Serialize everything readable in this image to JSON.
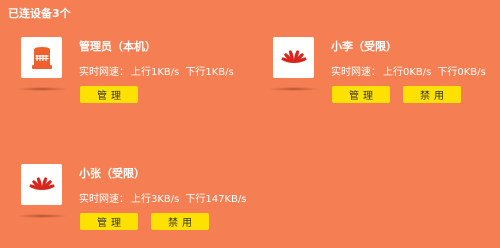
{
  "header": {
    "title": "已连设备3个"
  },
  "devices": [
    {
      "icon": "router-icon",
      "name": "管理员（本机）",
      "speed_label": "实时网速：",
      "upload": "上行1KB/s",
      "download": "下行1KB/s",
      "manage_label": "管理",
      "ban_label": ""
    },
    {
      "icon": "huawei-logo-icon",
      "name": "小李（受限）",
      "speed_label": "实时网速：",
      "upload": "上行0KB/s",
      "download": "下行0KB/s",
      "manage_label": "管理",
      "ban_label": "禁用"
    },
    {
      "icon": "huawei-logo-icon",
      "name": "小张（受限）",
      "speed_label": "实时网速：",
      "upload": "上行3KB/s",
      "download": "下行147KB/s",
      "manage_label": "管理",
      "ban_label": "禁用"
    }
  ],
  "colors": {
    "background": "#f57e52",
    "button": "#ffe100",
    "router_icon": "#f0602e",
    "huawei_icon": "#d9251c"
  }
}
